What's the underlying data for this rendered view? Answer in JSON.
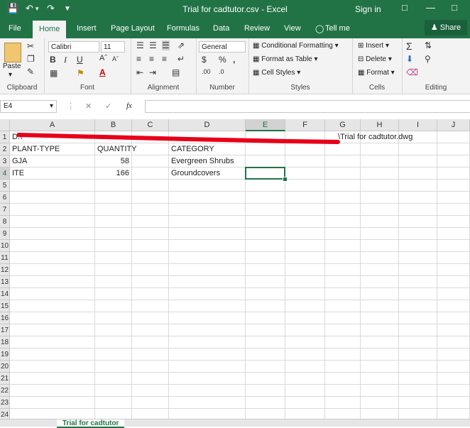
{
  "titlebar": {
    "title": "Trial for cadtutor.csv  -  Excel",
    "signin": "Sign in",
    "save_icon": "save-icon",
    "undo_icon": "undo-icon",
    "redo_icon": "redo-icon"
  },
  "tabs": {
    "file": "File",
    "home": "Home",
    "insert": "Insert",
    "page_layout": "Page Layout",
    "formulas": "Formulas",
    "data": "Data",
    "review": "Review",
    "view": "View",
    "tell_me": "Tell me",
    "share": "Share"
  },
  "ribbon": {
    "clipboard": {
      "paste": "Paste",
      "label": "Clipboard"
    },
    "font": {
      "name": "Calibri",
      "size": "11",
      "label": "Font"
    },
    "alignment": {
      "label": "Alignment"
    },
    "number": {
      "format": "General",
      "label": "Number"
    },
    "styles": {
      "conditional": "Conditional Formatting",
      "format_table": "Format as Table",
      "cell_styles": "Cell Styles",
      "label": "Styles"
    },
    "cells": {
      "insert": "Insert",
      "delete": "Delete",
      "format": "Format",
      "label": "Cells"
    },
    "editing": {
      "label": "Editing"
    }
  },
  "formula_bar": {
    "name_box": "E4",
    "fx": "fx",
    "value": ""
  },
  "grid": {
    "columns": [
      "A",
      "B",
      "C",
      "D",
      "E",
      "F",
      "G",
      "H",
      "I",
      "J"
    ],
    "selected_column": "E",
    "selected_row": "4",
    "rows": [
      "1",
      "2",
      "3",
      "4",
      "5",
      "6",
      "7",
      "8",
      "9",
      "10",
      "11",
      "12",
      "13",
      "14",
      "15",
      "16",
      "17",
      "18",
      "19",
      "20",
      "21",
      "22",
      "23",
      "24"
    ],
    "cells": {
      "A1_left": "D:\\",
      "A1_right": "\\Trial for cadtutor.dwg",
      "A2": "PLANT-TYPE",
      "B2": "QUANTITY",
      "D2": "CATEGORY",
      "A3": "GJA",
      "B3": "58",
      "D3": "Evergreen Shrubs",
      "A4": "ITE",
      "B4": "166",
      "D4": "Groundcovers"
    },
    "redaction_color": "#e8001a"
  },
  "sheet": {
    "tab": "Trial for cadtutor"
  }
}
